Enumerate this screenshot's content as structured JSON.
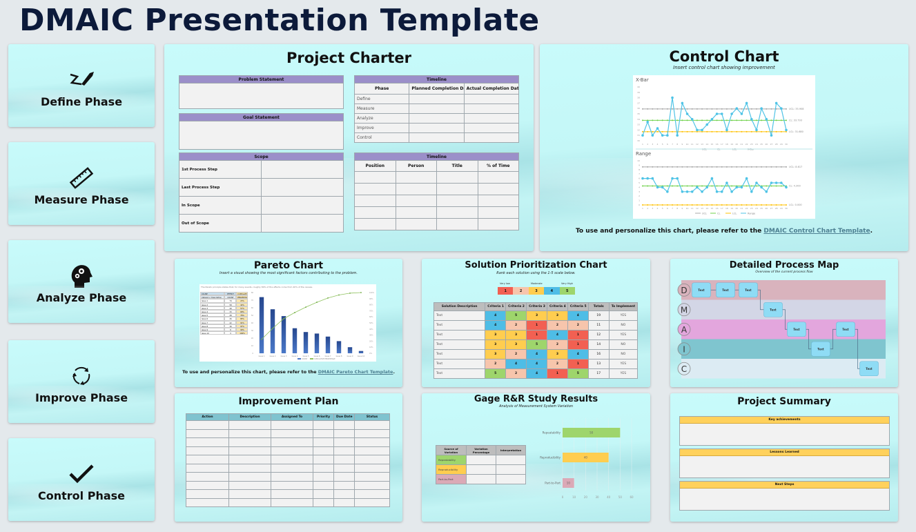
{
  "page_title": "DMAIC Presentation Template",
  "phases": [
    {
      "label": "Define Phase",
      "icon": "signature-pen-icon"
    },
    {
      "label": "Measure Phase",
      "icon": "ruler-icon"
    },
    {
      "label": "Analyze Phase",
      "icon": "head-gears-icon"
    },
    {
      "label": "Improve Phase",
      "icon": "cycle-arrows-icon"
    },
    {
      "label": "Control Phase",
      "icon": "checkmark-icon"
    }
  ],
  "charter": {
    "title": "Project Charter",
    "problem_statement": "Problem Statement",
    "goal_statement": "Goal Statement",
    "scope": {
      "header": "Scope",
      "rows": [
        "1st Process Step",
        "Last Process Step",
        "In Scope",
        "Out of Scope"
      ]
    },
    "timeline": {
      "header": "Timeline",
      "columns": [
        "Phase",
        "Planned Completion Date",
        "Actual Completion Date"
      ],
      "rows": [
        "Define",
        "Measure",
        "Analyze",
        "Improve",
        "Control"
      ]
    },
    "team": {
      "header": "Timeline",
      "columns": [
        "Position",
        "Person",
        "Title",
        "% of Time"
      ],
      "row_count": 5
    }
  },
  "control": {
    "title": "Control Chart",
    "subtitle": "Insert control chart showing improvement",
    "note_prefix": "To use and personalize this chart, please refer to the ",
    "note_link": "DMAIC Control Chart Template",
    "note_suffix": "."
  },
  "pareto": {
    "title": "Pareto Chart",
    "subtitle": "Insert a visual showing the most significant factors contributing to the problem.",
    "note_prefix": "To use and personalize this chart, please refer to the ",
    "note_link": "DMAIC Pareto Chart Template",
    "note_suffix": ".",
    "caption": "The Pareto principle states that, for many events, roughly 80% of the effects come from 20% of the causes.",
    "table_headers": [
      "CAUSE",
      "EFFECT",
      "CUMULATIVE"
    ],
    "table_subheaders": [
      "Category / Description",
      "COUNT",
      "PERCENTAGE"
    ],
    "rows": [
      [
        "Issue 1",
        "74",
        "23%"
      ],
      [
        "Issue 2",
        "58",
        "42%"
      ],
      [
        "Issue 3",
        "49",
        "57%"
      ],
      [
        "Issue 4",
        "33",
        "68%"
      ],
      [
        "Issue 5",
        "28",
        "76%"
      ],
      [
        "Issue 6",
        "26",
        "85%"
      ],
      [
        "Issue 7",
        "22",
        "91%"
      ],
      [
        "Issue 8",
        "16",
        "97%"
      ],
      [
        "Issue 9",
        "8",
        "99%"
      ],
      [
        "Issue 10",
        "3",
        "100%"
      ]
    ]
  },
  "solution": {
    "title": "Solution Prioritization Chart",
    "subtitle": "Rank each solution using the 1-5 scale below.",
    "scale_labels": [
      "Very low",
      "Moderate",
      "Very High"
    ],
    "scale": [
      "1",
      "2",
      "3",
      "4",
      "5"
    ],
    "scale_colors": {
      "1": "#f26052",
      "2": "#f7c5ac",
      "3": "#ffcd4f",
      "4": "#4ebde6",
      "5": "#9ed56c"
    },
    "columns": [
      "Solution Description",
      "Criteria 1",
      "Criteria 2",
      "Criteria 3",
      "Criteria 4",
      "Criteria 5",
      "Totals",
      "To Implement"
    ],
    "rows": [
      {
        "desc": "Text",
        "scores": [
          4,
          5,
          3,
          3,
          4
        ],
        "total": "19",
        "implement": "YES"
      },
      {
        "desc": "Text",
        "scores": [
          4,
          2,
          1,
          2,
          2
        ],
        "total": "11",
        "implement": "NO"
      },
      {
        "desc": "Text",
        "scores": [
          3,
          3,
          1,
          4,
          1
        ],
        "total": "12",
        "implement": "YES"
      },
      {
        "desc": "Text",
        "scores": [
          3,
          3,
          5,
          2,
          1
        ],
        "total": "14",
        "implement": "NO"
      },
      {
        "desc": "Text",
        "scores": [
          3,
          2,
          4,
          3,
          4
        ],
        "total": "16",
        "implement": "NO"
      },
      {
        "desc": "Text",
        "scores": [
          2,
          4,
          4,
          2,
          1
        ],
        "total": "13",
        "implement": "YES"
      },
      {
        "desc": "Text",
        "scores": [
          5,
          2,
          4,
          1,
          5
        ],
        "total": "17",
        "implement": "YES"
      }
    ]
  },
  "process_map": {
    "title": "Detailed Process Map",
    "subtitle": "Overview of the current process flow",
    "lanes": [
      {
        "letter": "D",
        "color": "#d9b3bd"
      },
      {
        "letter": "M",
        "color": "#d3d6e6"
      },
      {
        "letter": "A",
        "color": "#e3a6dd"
      },
      {
        "letter": "I",
        "color": "#7fc5cf"
      },
      {
        "letter": "C",
        "color": "#dcebf3"
      }
    ],
    "box_label": "Text"
  },
  "improvement": {
    "title": "Improvement Plan",
    "columns": [
      "Action",
      "Description",
      "Assigned To",
      "Priority",
      "Due Date",
      "Status"
    ],
    "row_count": 10
  },
  "gage": {
    "title": "Gage R&R Study Results",
    "subtitle": "Analysis of Measurement System Variation",
    "table_columns": [
      "Source of Variation",
      "Variation Percentage",
      "Interpretation"
    ],
    "table_rows": [
      {
        "label": "Repeatability",
        "color": "#9ed56c"
      },
      {
        "label": "Reproducibility",
        "color": "#ffcd4f"
      },
      {
        "label": "Part-to-Part",
        "color": "#dba9b6"
      }
    ]
  },
  "summary": {
    "title": "Project Summary",
    "sections": [
      "Key achievements",
      "Lessons Learned",
      "Next Steps"
    ]
  },
  "chart_data": [
    {
      "type": "line",
      "title": "X-Bar",
      "x": [
        1,
        2,
        3,
        4,
        5,
        6,
        7,
        8,
        9,
        10,
        11,
        12,
        13,
        14,
        15,
        16,
        17,
        18,
        19,
        20,
        21,
        22,
        23,
        24,
        25,
        26,
        27,
        28,
        29,
        30
      ],
      "ylim": [
        30,
        40
      ],
      "series": [
        {
          "name": "UCL",
          "color": "#a8a8a8",
          "values": [
            35.908,
            35.908,
            35.908,
            35.908,
            35.908,
            35.908,
            35.908,
            35.908,
            35.908,
            35.908,
            35.908,
            35.908,
            35.908,
            35.908,
            35.908,
            35.908,
            35.908,
            35.908,
            35.908,
            35.908,
            35.908,
            35.908,
            35.908,
            35.908,
            35.908,
            35.908,
            35.908,
            35.908,
            35.908,
            35.908
          ]
        },
        {
          "name": "CL",
          "color": "#6fd14a",
          "values": [
            33.793,
            33.793,
            33.793,
            33.793,
            33.793,
            33.793,
            33.793,
            33.793,
            33.793,
            33.793,
            33.793,
            33.793,
            33.793,
            33.793,
            33.793,
            33.793,
            33.793,
            33.793,
            33.793,
            33.793,
            33.793,
            33.793,
            33.793,
            33.793,
            33.793,
            33.793,
            33.793,
            33.793,
            33.793,
            33.793
          ]
        },
        {
          "name": "LCL",
          "color": "#ffc000",
          "values": [
            31.68,
            31.68,
            31.68,
            31.68,
            31.68,
            31.68,
            31.68,
            31.68,
            31.68,
            31.68,
            31.68,
            31.68,
            31.68,
            31.68,
            31.68,
            31.68,
            31.68,
            31.68,
            31.68,
            31.68,
            31.68,
            31.68,
            31.68,
            31.68,
            31.68,
            31.68,
            31.68,
            31.68,
            31.68,
            31.68
          ]
        },
        {
          "name": "X-Bar",
          "color": "#4ec3e6",
          "values": [
            31,
            33.5,
            31,
            32.3,
            31,
            31,
            38,
            31,
            37,
            35,
            34,
            32,
            32,
            33,
            34,
            35,
            35,
            32,
            35,
            36,
            35,
            37,
            34,
            32,
            36,
            34,
            31,
            37,
            36,
            32
          ]
        }
      ],
      "annotations": [
        "UCL: 35.908",
        "CL: 33.793",
        "LCL: 31.680"
      ],
      "legend": [
        "UCL",
        "CL",
        "LCL",
        "X-Bar"
      ]
    },
    {
      "type": "line",
      "title": "Range",
      "x": [
        1,
        2,
        3,
        4,
        5,
        6,
        7,
        8,
        9,
        10,
        11,
        12,
        13,
        14,
        15,
        16,
        17,
        18,
        19,
        20,
        21,
        22,
        23,
        24,
        25,
        26,
        27,
        28,
        29,
        30
      ],
      "ylim": [
        0,
        10
      ],
      "series": [
        {
          "name": "UCL",
          "color": "#a8a8a8",
          "values": [
            8.617,
            8.617,
            8.617,
            8.617,
            8.617,
            8.617,
            8.617,
            8.617,
            8.617,
            8.617,
            8.617,
            8.617,
            8.617,
            8.617,
            8.617,
            8.617,
            8.617,
            8.617,
            8.617,
            8.617,
            8.617,
            8.617,
            8.617,
            8.617,
            8.617,
            8.617,
            8.617,
            8.617,
            8.617,
            8.617
          ]
        },
        {
          "name": "CL",
          "color": "#6fd14a",
          "values": [
            4.3,
            4.3,
            4.3,
            4.3,
            4.3,
            4.3,
            4.3,
            4.3,
            4.3,
            4.3,
            4.3,
            4.3,
            4.3,
            4.3,
            4.3,
            4.3,
            4.3,
            4.3,
            4.3,
            4.3,
            4.3,
            4.3,
            4.3,
            4.3,
            4.3,
            4.3,
            4.3,
            4.3,
            4.3,
            4.3
          ]
        },
        {
          "name": "LCL",
          "color": "#ffc000",
          "values": [
            0,
            0,
            0,
            0,
            0,
            0,
            0,
            0,
            0,
            0,
            0,
            0,
            0,
            0,
            0,
            0,
            0,
            0,
            0,
            0,
            0,
            0,
            0,
            0,
            0,
            0,
            0,
            0,
            0,
            0
          ]
        },
        {
          "name": "Range",
          "color": "#4ec3e6",
          "values": [
            6,
            6,
            6,
            4,
            4,
            3,
            6,
            6,
            3,
            3,
            3,
            4,
            3,
            4,
            6,
            3,
            3,
            5,
            3,
            4,
            4,
            6,
            3,
            5,
            4,
            3,
            5,
            5,
            5,
            4
          ]
        }
      ],
      "annotations": [
        "UCL: 8.617",
        "CL: 4.300",
        "LCL: 0.000"
      ],
      "legend": [
        "UCL",
        "CL",
        "LCL",
        "Range"
      ]
    },
    {
      "type": "bar",
      "title": "Pareto",
      "categories": [
        "Issue 1",
        "Issue 2",
        "Issue 3",
        "Issue 4",
        "Issue 5",
        "Issue 6",
        "Issue 7",
        "Issue 8",
        "Issue 9",
        "Issue 10"
      ],
      "series": [
        {
          "name": "COUNT",
          "color": "#2f56a0",
          "values": [
            74,
            58,
            49,
            33,
            28,
            26,
            22,
            16,
            8,
            3
          ]
        },
        {
          "name": "CUMULATIVE PERCENTAGE",
          "color": "#8fc25e",
          "type": "line",
          "values": [
            23,
            41,
            57,
            67,
            76,
            84,
            91,
            96,
            99,
            100
          ]
        }
      ],
      "ylim": [
        0,
        80
      ],
      "y2lim": [
        0,
        100
      ],
      "legend": [
        "COUNT",
        "CUMULATIVE PERCENTAGE"
      ]
    },
    {
      "type": "bar",
      "title": "Gage R&R",
      "orientation": "horizontal",
      "categories": [
        "Repeatability",
        "Reproducibility",
        "Part-to-Part"
      ],
      "values": [
        50,
        40,
        10
      ],
      "colors": [
        "#9ed56c",
        "#ffcd4f",
        "#dba9b6"
      ],
      "xlim": [
        0,
        60
      ],
      "xticks": [
        0,
        10,
        20,
        30,
        40,
        50,
        60
      ]
    }
  ]
}
